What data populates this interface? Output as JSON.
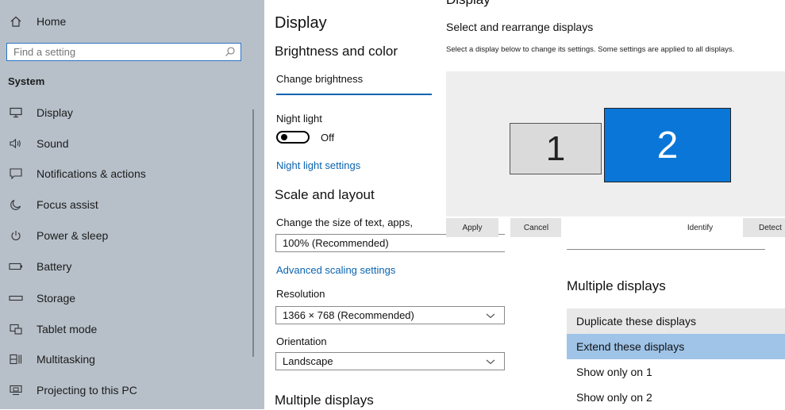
{
  "sidebar": {
    "home_label": "Home",
    "search_placeholder": "Find a setting",
    "section_title": "System",
    "items": [
      {
        "label": "Display"
      },
      {
        "label": "Sound"
      },
      {
        "label": "Notifications & actions"
      },
      {
        "label": "Focus assist"
      },
      {
        "label": "Power & sleep"
      },
      {
        "label": "Battery"
      },
      {
        "label": "Storage"
      },
      {
        "label": "Tablet mode"
      },
      {
        "label": "Multitasking"
      },
      {
        "label": "Projecting to this PC"
      }
    ]
  },
  "settings": {
    "title": "Display",
    "brightness_heading": "Brightness and color",
    "change_brightness": "Change brightness",
    "night_light_label": "Night light",
    "night_light_state": "Off",
    "night_light_link": "Night light settings",
    "scale_heading": "Scale and layout",
    "scale_desc": "Change the size of text, apps,",
    "scale_value": "100% (Recommended)",
    "advanced_scaling_link": "Advanced scaling settings",
    "resolution_label": "Resolution",
    "resolution_value": "1366 × 768 (Recommended)",
    "orientation_label": "Orientation",
    "orientation_value": "Landscape",
    "multiple_displays_heading": "Multiple displays"
  },
  "arrange": {
    "top_cut_title": "Display",
    "heading": "Select and rearrange displays",
    "description": "Select a display below to change its settings. Some settings are applied to all displays.",
    "monitor_1": "1",
    "monitor_2": "2",
    "apply": "Apply",
    "cancel": "Cancel",
    "identify": "Identify",
    "detect": "Detect",
    "multiple_displays_heading": "Multiple displays",
    "options": [
      {
        "label": "Duplicate these displays"
      },
      {
        "label": "Extend these displays"
      },
      {
        "label": "Show only on 1"
      },
      {
        "label": "Show only on 2"
      }
    ],
    "selected_option": "Extend these displays"
  },
  "colors": {
    "sidebar_bg": "#b7c0c9",
    "accent_blue": "#0a77d8",
    "link_blue": "#0a64b0",
    "selected_option_bg": "#9fc4e8"
  }
}
